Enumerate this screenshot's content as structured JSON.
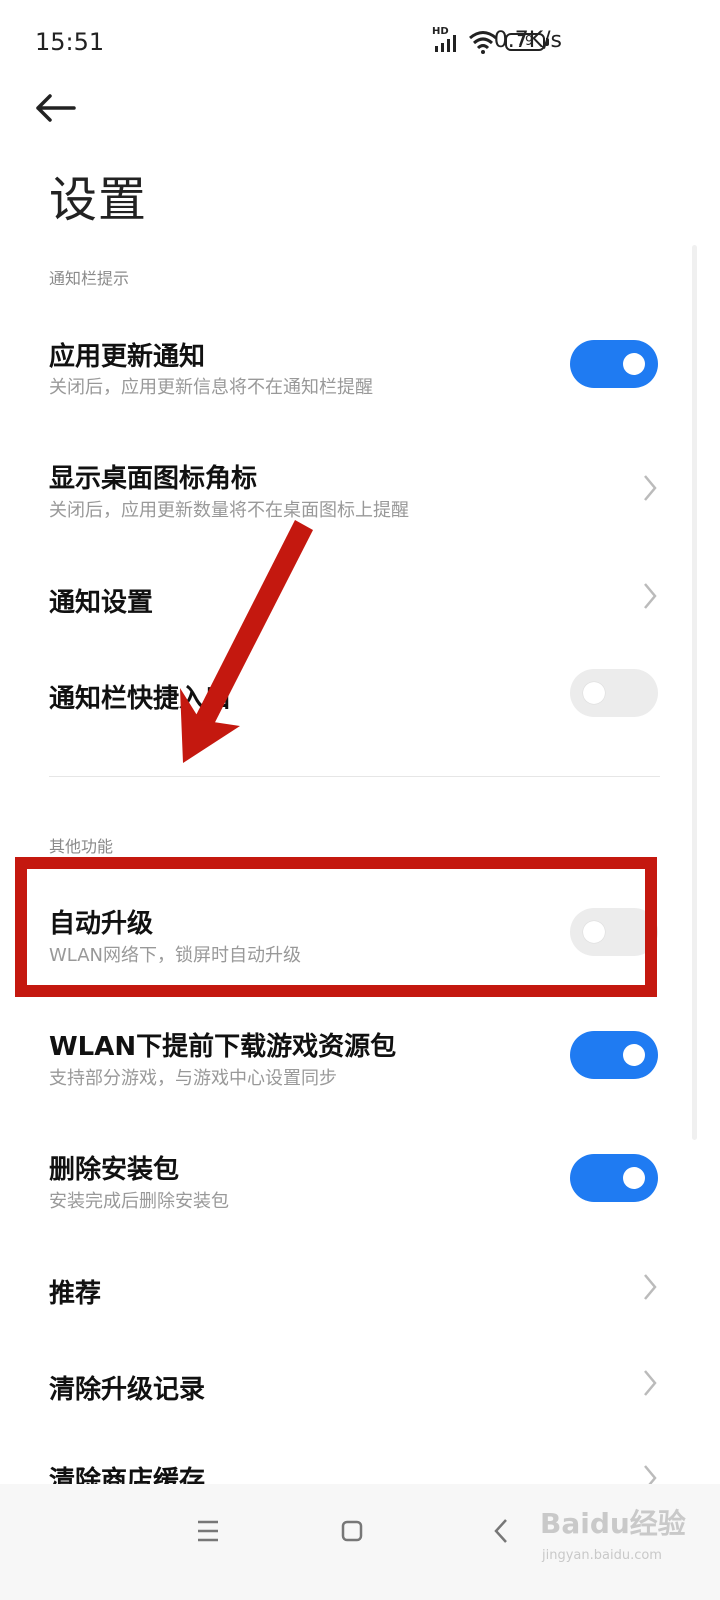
{
  "status_bar": {
    "time": "15:51",
    "network_speed": "0.7K/s",
    "hd_label": "HD",
    "battery_level": "79",
    "icons": [
      "signal-icon",
      "wifi-icon",
      "battery-icon"
    ]
  },
  "header": {
    "back_icon": "arrow-left-icon",
    "title": "设置"
  },
  "sections": [
    {
      "header": "通知栏提示",
      "items": [
        {
          "title": "应用更新通知",
          "subtitle": "关闭后，应用更新信息将不在通知栏提醒",
          "control": "toggle",
          "checked": true
        },
        {
          "title": "显示桌面图标角标",
          "subtitle": "关闭后，应用更新数量将不在桌面图标上提醒",
          "control": "chevron"
        },
        {
          "title": "通知设置",
          "control": "chevron"
        },
        {
          "title": "通知栏快捷入口",
          "control": "toggle",
          "checked": false
        }
      ]
    },
    {
      "header": "其他功能",
      "items": [
        {
          "title": "自动升级",
          "subtitle": "WLAN网络下，锁屏时自动升级",
          "control": "toggle",
          "checked": false
        },
        {
          "title": "WLAN下提前下载游戏资源包",
          "subtitle": "支持部分游戏，与游戏中心设置同步",
          "control": "toggle",
          "checked": true
        },
        {
          "title": "删除安装包",
          "subtitle": "安装完成后删除安装包",
          "control": "toggle",
          "checked": true
        },
        {
          "title": "推荐",
          "control": "chevron"
        },
        {
          "title": "清除升级记录",
          "control": "chevron"
        },
        {
          "title": "清除商店缓存",
          "control": "chevron"
        }
      ]
    }
  ],
  "nav_bar": {
    "icons": [
      "menu-icon",
      "home-icon",
      "back-icon"
    ]
  },
  "watermark": {
    "logo": "Baidu经验",
    "url": "jingyan.baidu.com"
  },
  "colors": {
    "toggle_on": "#1f7bf2",
    "toggle_off": "#ececec",
    "annotation_red": "#c4180f"
  }
}
